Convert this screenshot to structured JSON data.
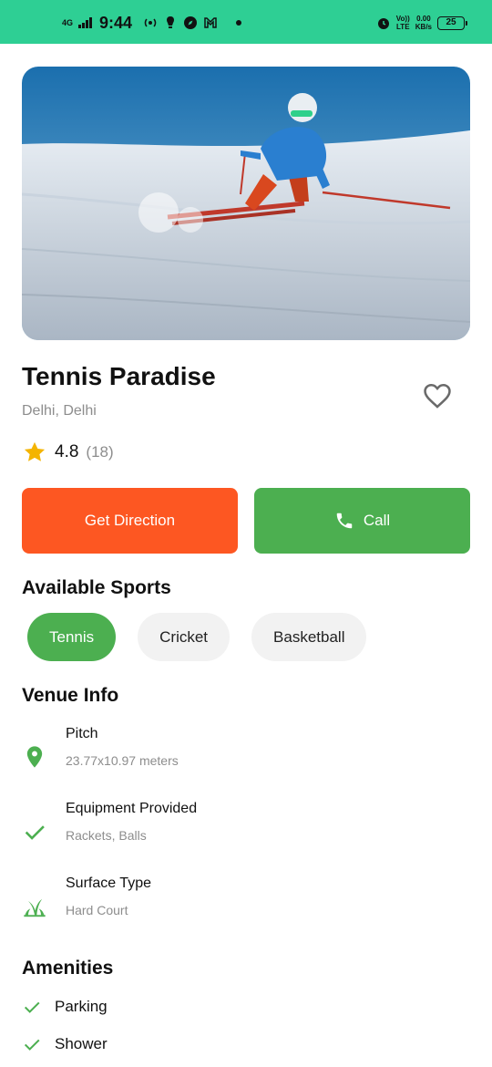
{
  "status_bar": {
    "network": "4G",
    "time": "9:44",
    "volte": "Vo))",
    "lte": "LTE",
    "speed_value": "0.00",
    "speed_unit": "KB/s",
    "battery": "25"
  },
  "hero": {
    "icon": "skier-photo"
  },
  "venue": {
    "name": "Tennis Paradise",
    "location": "Delhi, Delhi",
    "rating": "4.8",
    "rating_count": "(18)"
  },
  "actions": {
    "direction_label": "Get Direction",
    "call_label": "Call"
  },
  "sports": {
    "title": "Available Sports",
    "items": [
      {
        "label": "Tennis",
        "selected": true
      },
      {
        "label": "Cricket",
        "selected": false
      },
      {
        "label": "Basketball",
        "selected": false
      }
    ]
  },
  "venue_info": {
    "title": "Venue Info",
    "items": [
      {
        "icon": "location-pin-icon",
        "label": "Pitch",
        "value": "23.77x10.97 meters"
      },
      {
        "icon": "check-icon",
        "label": "Equipment Provided",
        "value": "Rackets, Balls"
      },
      {
        "icon": "grass-icon",
        "label": "Surface Type",
        "value": "Hard Court"
      }
    ]
  },
  "amenities": {
    "title": "Amenities",
    "items": [
      {
        "icon": "check-icon",
        "label": "Parking"
      },
      {
        "icon": "check-icon",
        "label": "Shower"
      }
    ]
  },
  "colors": {
    "status_bar": "#2ecf94",
    "primary_green": "#4caf50",
    "direction_orange": "#fd5722",
    "star": "#f4b400",
    "secondary_text": "#8d8d8d"
  }
}
